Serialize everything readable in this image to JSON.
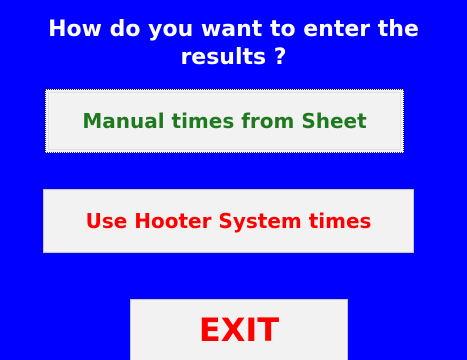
{
  "dialog": {
    "prompt": "How do you want to enter the\nresults ?",
    "buttons": {
      "manual_label": "Manual times from Sheet",
      "hooter_label": "Use Hooter System times",
      "exit_label": "EXIT"
    }
  },
  "colors": {
    "background": "#0000ff",
    "prompt_text": "#ffffff",
    "button_face": "#f2f2f2",
    "manual_text": "#1f7a1f",
    "hooter_text": "#ff0000",
    "exit_text": "#ff0000"
  }
}
